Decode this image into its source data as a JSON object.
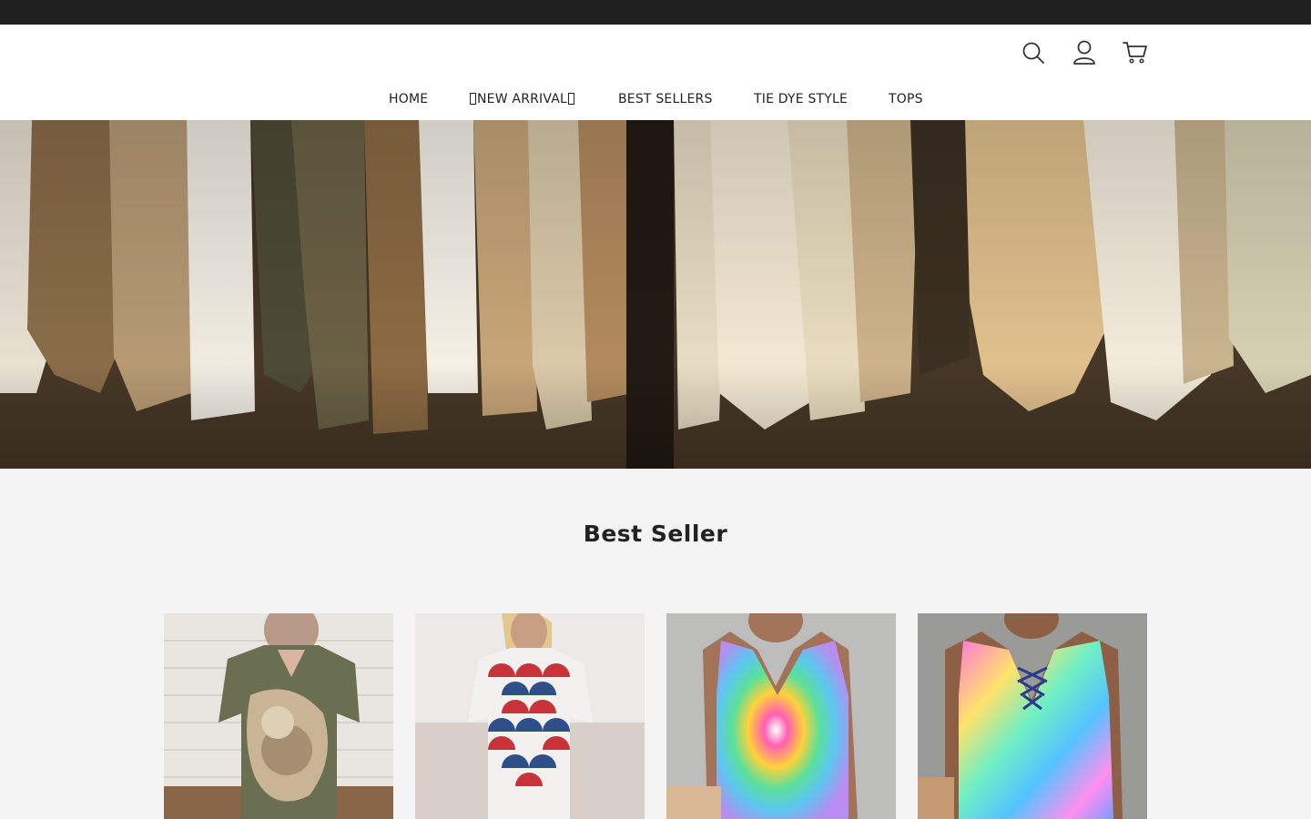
{
  "nav": {
    "items": [
      {
        "label": "HOME"
      },
      {
        "label": "NEW ARRIVAL"
      },
      {
        "label": "BEST SELLERS"
      },
      {
        "label": "TIE DYE STYLE"
      },
      {
        "label": "TOPS"
      }
    ]
  },
  "header": {
    "icons": [
      "search-icon",
      "account-icon",
      "cart-icon"
    ]
  },
  "hero": {
    "image": "clothes-rack-banner"
  },
  "best_seller": {
    "title": "Best Seller",
    "products": [
      {
        "image": "olive-floral-cutout-top"
      },
      {
        "image": "red-blue-scale-print-tee"
      },
      {
        "image": "rainbow-tie-dye-tank"
      },
      {
        "image": "holographic-lace-up-tank"
      }
    ]
  },
  "colors": {
    "topbar": "#202020",
    "header_bg": "#ffffff",
    "page_bg": "#f4f4f4",
    "text": "#222222"
  }
}
